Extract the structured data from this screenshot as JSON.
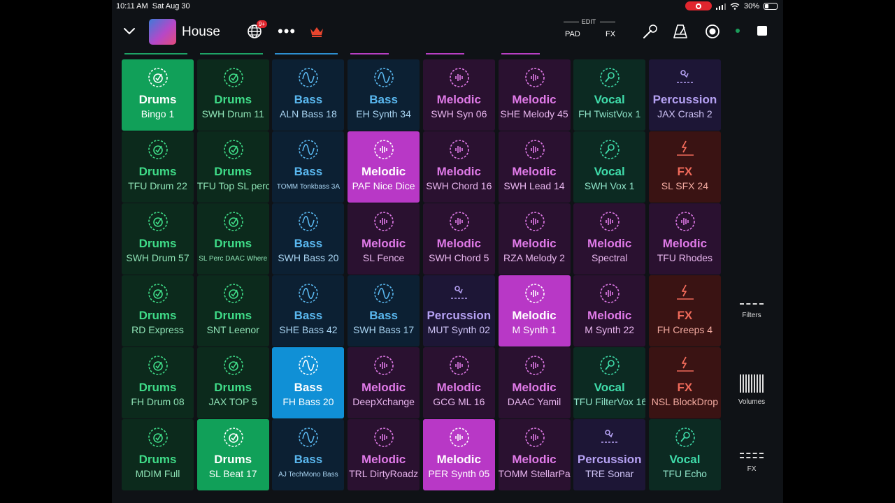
{
  "status": {
    "time": "10:11 AM",
    "date": "Sat Aug 30",
    "battery": "30%"
  },
  "header": {
    "title": "House",
    "badge": "9+",
    "more": "•••",
    "edit_label": "EDIT",
    "pad_label": "PAD",
    "fx_label": "FX"
  },
  "colors": {
    "Drums": {
      "bg": "#0c2a1c",
      "active": "#11a059",
      "cat": "#3fdc88",
      "name": "#8fe3b6",
      "icon": "#3fdc88"
    },
    "Bass": {
      "bg": "#0c2033",
      "active": "#1090d6",
      "cat": "#5ab8f0",
      "name": "#a9d4f2",
      "icon": "#5ab8f0"
    },
    "Melodic": {
      "bg": "#2a1130",
      "active": "#b838c6",
      "cat": "#e07ae8",
      "name": "#e8b6ee",
      "icon": "#e07ae8"
    },
    "Vocal": {
      "bg": "#0c2a22",
      "active": "#11a070",
      "cat": "#3fdcaa",
      "name": "#8fe3c8",
      "icon": "#3fdcaa"
    },
    "Percussion": {
      "bg": "#1d1636",
      "active": "#6a4ad0",
      "cat": "#b6a2f4",
      "name": "#cfc4f7",
      "icon": "#b6a2f4"
    },
    "FX": {
      "bg": "#3a1313",
      "active": "#c83030",
      "cat": "#f06a5a",
      "name": "#f2aaa0",
      "icon": "#f06a5a"
    }
  },
  "column_indicators": [
    "#1ea366",
    "#1ea366",
    "#2d8fd0",
    "#b83fc4",
    "#b83fc4",
    "#b83fc4"
  ],
  "pads": [
    [
      {
        "cat": "Drums",
        "name": "Bingo 1",
        "active": true
      },
      {
        "cat": "Drums",
        "name": "SWH Drum 11"
      },
      {
        "cat": "Bass",
        "name": "ALN Bass 18"
      },
      {
        "cat": "Bass",
        "name": "EH Synth 34"
      },
      {
        "cat": "Melodic",
        "name": "SWH Syn 06"
      },
      {
        "cat": "Melodic",
        "name": "SHE Melody 45"
      },
      {
        "cat": "Vocal",
        "name": "FH TwistVox 1"
      },
      {
        "cat": "Percussion",
        "name": "JAX Crash 2"
      }
    ],
    [
      {
        "cat": "Drums",
        "name": "TFU Drum 22"
      },
      {
        "cat": "Drums",
        "name": "TFU Top SL perc"
      },
      {
        "cat": "Bass",
        "name": "TOMM Tonkbass 3A",
        "small": true
      },
      {
        "cat": "Melodic",
        "name": "PAF Nice Dice",
        "active": true
      },
      {
        "cat": "Melodic",
        "name": "SWH Chord 16"
      },
      {
        "cat": "Melodic",
        "name": "SWH Lead 14"
      },
      {
        "cat": "Vocal",
        "name": "SWH Vox 1"
      },
      {
        "cat": "FX",
        "name": "SL SFX 24"
      }
    ],
    [
      {
        "cat": "Drums",
        "name": "SWH Drum 57"
      },
      {
        "cat": "Drums",
        "name": "SL Perc DAAC Where",
        "small": true
      },
      {
        "cat": "Bass",
        "name": "SWH Bass 20"
      },
      {
        "cat": "Melodic",
        "name": "SL Fence"
      },
      {
        "cat": "Melodic",
        "name": "SWH Chord 5"
      },
      {
        "cat": "Melodic",
        "name": "RZA Melody 2"
      },
      {
        "cat": "Melodic",
        "name": "Spectral"
      },
      {
        "cat": "Melodic",
        "name": "TFU Rhodes"
      }
    ],
    [
      {
        "cat": "Drums",
        "name": "RD Express"
      },
      {
        "cat": "Drums",
        "name": "SNT Leenor"
      },
      {
        "cat": "Bass",
        "name": "SHE Bass 42"
      },
      {
        "cat": "Bass",
        "name": "SWH Bass 17"
      },
      {
        "cat": "Percussion",
        "name": "MUT Synth 02"
      },
      {
        "cat": "Melodic",
        "name": "M Synth 1",
        "active": true
      },
      {
        "cat": "Melodic",
        "name": "M Synth 22"
      },
      {
        "cat": "FX",
        "name": "FH Creeps 4"
      }
    ],
    [
      {
        "cat": "Drums",
        "name": "FH Drum 08"
      },
      {
        "cat": "Drums",
        "name": "JAX TOP 5"
      },
      {
        "cat": "Bass",
        "name": "FH Bass 20",
        "active": true
      },
      {
        "cat": "Melodic",
        "name": "DeepXchange"
      },
      {
        "cat": "Melodic",
        "name": "GCG ML 16"
      },
      {
        "cat": "Melodic",
        "name": "DAAC Yamil"
      },
      {
        "cat": "Vocal",
        "name": "TFU FilterVox 16"
      },
      {
        "cat": "FX",
        "name": "NSL BlockDrop"
      }
    ],
    [
      {
        "cat": "Drums",
        "name": "MDIM Full"
      },
      {
        "cat": "Drums",
        "name": "SL Beat 17",
        "active": true
      },
      {
        "cat": "Bass",
        "name": "AJ TechMono Bass",
        "small": true
      },
      {
        "cat": "Melodic",
        "name": "TRL DirtyRoadz"
      },
      {
        "cat": "Melodic",
        "name": "PER Synth 05",
        "active": true
      },
      {
        "cat": "Melodic",
        "name": "TOMM StellarPad"
      },
      {
        "cat": "Percussion",
        "name": "TRE Sonar"
      },
      {
        "cat": "Vocal",
        "name": "TFU Echo"
      }
    ]
  ],
  "side": {
    "filters": "Filters",
    "volumes": "Volumes",
    "fx": "FX"
  }
}
